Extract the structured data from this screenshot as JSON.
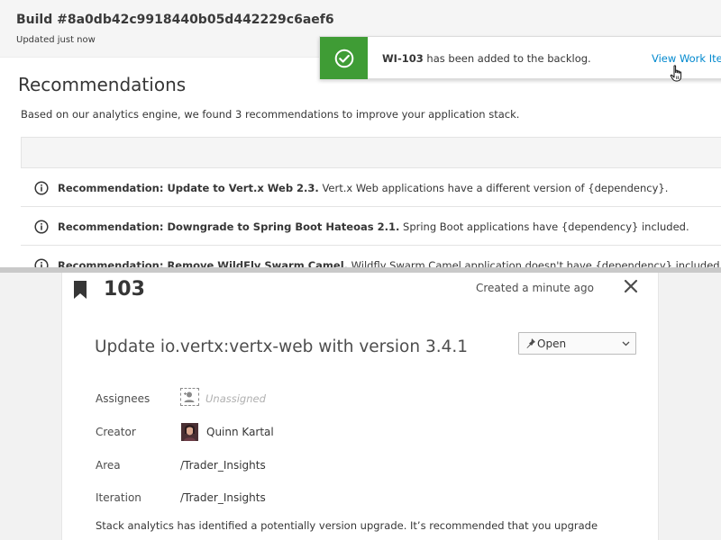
{
  "build": {
    "title": "Build #8a0db42c9918440b05d442229c6aef6",
    "updated": "Updated just now"
  },
  "recommendations": {
    "heading": "Recommendations",
    "subtitle": "Based on our analytics engine, we found 3 recommendations to improve your application stack.",
    "items": [
      {
        "bold": "Recommendation: Update to Vert.x Web 2.3.",
        "text": " Vert.x Web applications have a different version of {dependency}."
      },
      {
        "bold": "Recommendation: Downgrade to Spring Boot Hateoas 2.1.",
        "text": " Spring Boot applications have {dependency} included."
      },
      {
        "bold": "Recommendation: Remove WildFly Swarm Camel.",
        "text": " Wildfly Swarm Camel application doesn't have {dependency} included."
      }
    ]
  },
  "toast": {
    "id": "WI-103",
    "message": " has been added to the backlog.",
    "link": "View Work Ite",
    "color": "#3f9c35"
  },
  "work_item": {
    "id": "103",
    "created": "Created a minute ago",
    "title": "Update io.vertx:vertx-web with version 3.4.1",
    "state": "Open",
    "fields": {
      "assignees_label": "Assignees",
      "assignees_value": "Unassigned",
      "creator_label": "Creator",
      "creator_value": "Quinn Kartal",
      "area_label": "Area",
      "area_value": "/Trader_Insights",
      "iteration_label": "Iteration",
      "iteration_value": "/Trader_Insights"
    },
    "description": "Stack analytics has identified a potentially version upgrade. It’s recommended that you upgrade"
  },
  "icons": {
    "toast": "check-circle-icon",
    "info": "info-circle-icon",
    "bookmark": "bookmark-icon",
    "close": "close-icon",
    "state": "pin-icon",
    "dropdown": "chevron-down-icon",
    "cursor": "hand-cursor-icon",
    "assignee": "add-user-icon"
  },
  "colors": {
    "link": "#0088ce",
    "success": "#3f9c35"
  }
}
